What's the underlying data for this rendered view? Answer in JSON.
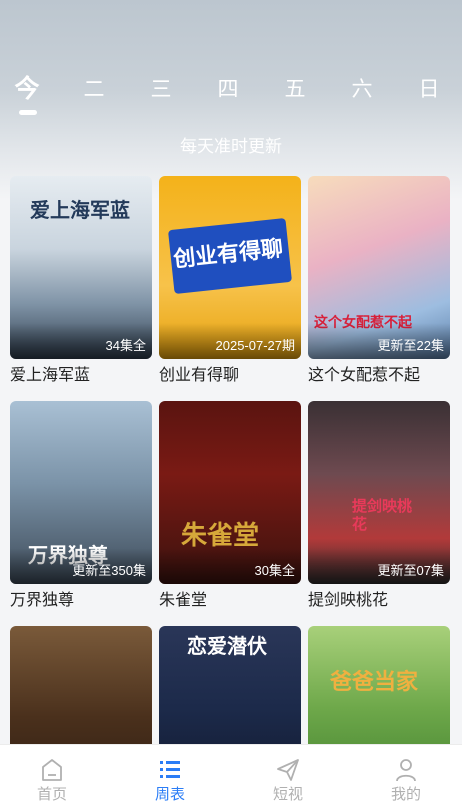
{
  "week_tabs": {
    "days": [
      "今",
      "二",
      "三",
      "四",
      "五",
      "六",
      "日"
    ],
    "active_index": 0
  },
  "subtitle": "每天准时更新",
  "shows": [
    {
      "title": "爱上海军蓝",
      "badge": "34集全",
      "poster_text": "爱上海军蓝",
      "palette": [
        "#dfe6ec",
        "#8da4b8",
        "#2e3b4a"
      ]
    },
    {
      "title": "创业有得聊",
      "badge": "2025-07-27期",
      "poster_text": "创业有得聊",
      "palette": [
        "#f5b417",
        "#f8c64a",
        "#1f4fbf"
      ]
    },
    {
      "title": "这个女配惹不起",
      "badge": "更新至22集",
      "poster_text": "这个女配惹不起",
      "palette": [
        "#f2c9a4",
        "#e89bb6",
        "#4f7fb0"
      ]
    },
    {
      "title": "万界独尊",
      "badge": "更新至350集",
      "poster_text": "万界独尊",
      "palette": [
        "#9fb7cc",
        "#5d7386",
        "#2a3340"
      ]
    },
    {
      "title": "朱雀堂",
      "badge": "30集全",
      "poster_text": "朱雀堂",
      "palette": [
        "#7a1a14",
        "#3a120e",
        "#c8a03a"
      ]
    },
    {
      "title": "提剑映桃花",
      "badge": "更新至07集",
      "poster_text": "提剑映桃花",
      "palette": [
        "#e4d6d6",
        "#b23a3a",
        "#2c2c2c"
      ]
    },
    {
      "title": "",
      "badge": "",
      "poster_text": "",
      "palette": [
        "#5a3a22",
        "#2a1a10",
        "#c88a3a"
      ]
    },
    {
      "title": "",
      "badge": "",
      "poster_text": "恋爱潜伏",
      "palette": [
        "#1c2a4a",
        "#10162a",
        "#6a7aa0"
      ]
    },
    {
      "title": "",
      "badge": "",
      "poster_text": "爸爸当家",
      "palette": [
        "#6ea84a",
        "#a8d07a",
        "#f0b040"
      ]
    }
  ],
  "tab_bar": {
    "items": [
      {
        "label": "首页",
        "icon": "home-icon"
      },
      {
        "label": "周表",
        "icon": "list-icon"
      },
      {
        "label": "短视",
        "icon": "paper-plane-icon"
      },
      {
        "label": "我的",
        "icon": "user-icon"
      }
    ],
    "active_index": 1,
    "active_color": "#2b7df6",
    "inactive_color": "#b0b0b0"
  }
}
